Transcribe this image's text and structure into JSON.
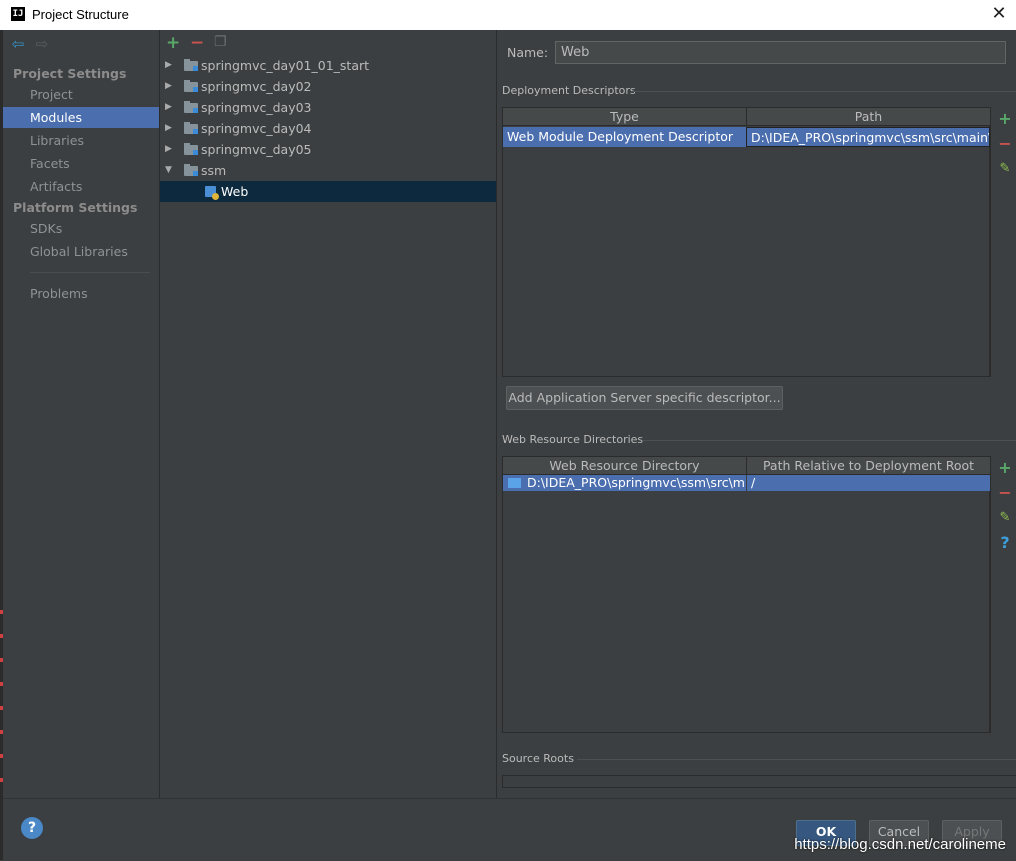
{
  "window": {
    "title": "Project Structure",
    "app_icon_text": "IJ"
  },
  "sidebar": {
    "project_settings_header": "Project Settings",
    "platform_settings_header": "Platform Settings",
    "items": [
      {
        "label": "Project"
      },
      {
        "label": "Modules"
      },
      {
        "label": "Libraries"
      },
      {
        "label": "Facets"
      },
      {
        "label": "Artifacts"
      },
      {
        "label": "SDKs"
      },
      {
        "label": "Global Libraries"
      },
      {
        "label": "Problems"
      }
    ],
    "selected": "Modules"
  },
  "tree": {
    "nodes": [
      {
        "label": "springmvc_day01_01_start"
      },
      {
        "label": "springmvc_day02"
      },
      {
        "label": "springmvc_day03"
      },
      {
        "label": "springmvc_day04"
      },
      {
        "label": "springmvc_day05"
      },
      {
        "label": "ssm"
      },
      {
        "label": "Web"
      }
    ]
  },
  "main": {
    "name_label": "Name:",
    "name_value": "Web",
    "deployment": {
      "title": "Deployment Descriptors",
      "columns": [
        "Type",
        "Path"
      ],
      "rows": [
        {
          "type": "Web Module Deployment Descriptor",
          "path": "D:\\IDEA_PRO\\springmvc\\ssm\\src\\main\\we"
        }
      ],
      "add_server_button": "Add Application Server specific descriptor..."
    },
    "web_resources": {
      "title": "Web Resource Directories",
      "columns": [
        "Web Resource Directory",
        "Path Relative to Deployment Root"
      ],
      "rows": [
        {
          "dir": "D:\\IDEA_PRO\\springmvc\\ssm\\src\\m...",
          "rel": "/"
        }
      ]
    },
    "source_roots": {
      "title": "Source Roots"
    }
  },
  "footer": {
    "help_label": "?",
    "ok_label": "OK",
    "cancel_label": "Cancel",
    "apply_label": "Apply",
    "watermark": "https://blog.csdn.net/carolineme"
  },
  "colors": {
    "accent": "#4b6eaf",
    "background": "#3c3f41",
    "tree_selection": "#0d293e"
  }
}
